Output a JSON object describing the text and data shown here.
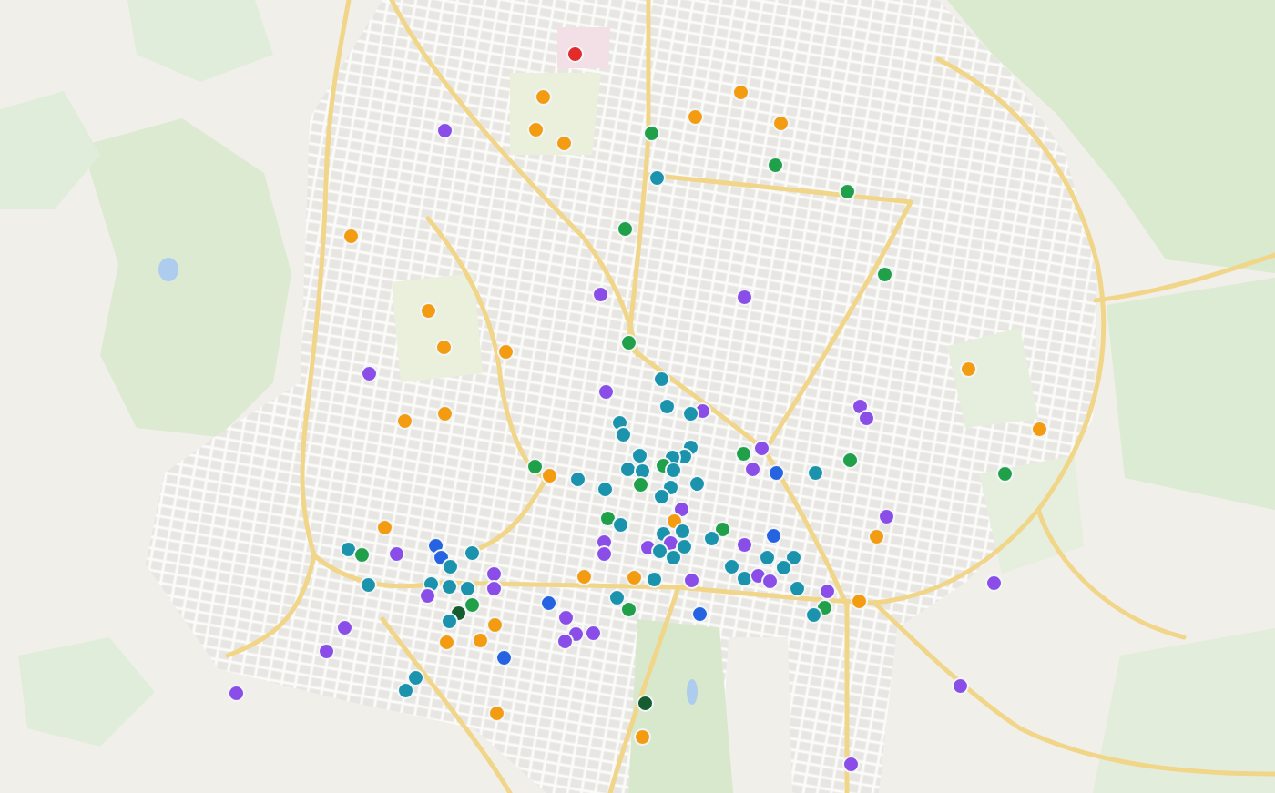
{
  "map": {
    "markers": [
      {
        "color": "#e32b2b"
      },
      {
        "color": "#f39c12"
      },
      {
        "color": "#f39c12"
      },
      {
        "color": "#f39c12"
      },
      {
        "color": "#8b4de8"
      },
      {
        "color": "#21a04a"
      },
      {
        "color": "#f39c12"
      },
      {
        "color": "#f39c12"
      },
      {
        "color": "#f39c12"
      },
      {
        "color": "#21a04a"
      },
      {
        "color": "#1b93ad"
      },
      {
        "color": "#21a04a"
      },
      {
        "color": "#21a04a"
      },
      {
        "color": "#f39c12"
      },
      {
        "color": "#21a04a"
      },
      {
        "color": "#8b4de8"
      },
      {
        "color": "#8b4de8"
      },
      {
        "color": "#f39c12"
      },
      {
        "color": "#f39c12"
      },
      {
        "color": "#f39c12"
      },
      {
        "color": "#21a04a"
      },
      {
        "color": "#8b4de8"
      },
      {
        "color": "#f39c12"
      },
      {
        "color": "#1b93ad"
      },
      {
        "color": "#8b4de8"
      },
      {
        "color": "#1b93ad"
      },
      {
        "color": "#8b4de8"
      },
      {
        "color": "#1b93ad"
      },
      {
        "color": "#8b4de8"
      },
      {
        "color": "#8b4de8"
      },
      {
        "color": "#f39c12"
      },
      {
        "color": "#f39c12"
      },
      {
        "color": "#f39c12"
      },
      {
        "color": "#1b93ad"
      },
      {
        "color": "#1b93ad"
      },
      {
        "color": "#1b93ad"
      },
      {
        "color": "#1b93ad"
      },
      {
        "color": "#1b93ad"
      },
      {
        "color": "#1b93ad"
      },
      {
        "color": "#21a04a"
      },
      {
        "color": "#1b93ad"
      },
      {
        "color": "#1b93ad"
      },
      {
        "color": "#1b93ad"
      },
      {
        "color": "#21a04a"
      },
      {
        "color": "#1b93ad"
      },
      {
        "color": "#21a04a"
      },
      {
        "color": "#f39c12"
      },
      {
        "color": "#1b93ad"
      },
      {
        "color": "#1b93ad"
      },
      {
        "color": "#1b93ad"
      },
      {
        "color": "#1b93ad"
      },
      {
        "color": "#8b4de8"
      },
      {
        "color": "#21a04a"
      },
      {
        "color": "#8b4de8"
      },
      {
        "color": "#2563e0"
      },
      {
        "color": "#1b93ad"
      },
      {
        "color": "#21a04a"
      },
      {
        "color": "#21a04a"
      },
      {
        "color": "#8b4de8"
      },
      {
        "color": "#f39c12"
      },
      {
        "color": "#21a04a"
      },
      {
        "color": "#1b93ad"
      },
      {
        "color": "#1b93ad"
      },
      {
        "color": "#1b93ad"
      },
      {
        "color": "#21a04a"
      },
      {
        "color": "#1b93ad"
      },
      {
        "color": "#2563e0"
      },
      {
        "color": "#8b4de8"
      },
      {
        "color": "#f39c12"
      },
      {
        "color": "#f39c12"
      },
      {
        "color": "#1b93ad"
      },
      {
        "color": "#21a04a"
      },
      {
        "color": "#8b4de8"
      },
      {
        "color": "#2563e0"
      },
      {
        "color": "#2563e0"
      },
      {
        "color": "#1b93ad"
      },
      {
        "color": "#1b93ad"
      },
      {
        "color": "#8b4de8"
      },
      {
        "color": "#8b4de8"
      },
      {
        "color": "#8b4de8"
      },
      {
        "color": "#8b4de8"
      },
      {
        "color": "#1b93ad"
      },
      {
        "color": "#1b93ad"
      },
      {
        "color": "#1b93ad"
      },
      {
        "color": "#8b4de8"
      },
      {
        "color": "#1b93ad"
      },
      {
        "color": "#1b93ad"
      },
      {
        "color": "#1b93ad"
      },
      {
        "color": "#1b93ad"
      },
      {
        "color": "#1b93ad"
      },
      {
        "color": "#8b4de8"
      },
      {
        "color": "#8b4de8"
      },
      {
        "color": "#1b93ad"
      },
      {
        "color": "#8b4de8"
      },
      {
        "color": "#f39c12"
      },
      {
        "color": "#21a04a"
      },
      {
        "color": "#1b93ad"
      },
      {
        "color": "#8b4de8"
      },
      {
        "color": "#8b4de8"
      },
      {
        "color": "#8b4de8"
      },
      {
        "color": "#1b93ad"
      },
      {
        "color": "#1b93ad"
      },
      {
        "color": "#8b4de8"
      },
      {
        "color": "#1b93ad"
      },
      {
        "color": "#1b93ad"
      },
      {
        "color": "#f39c12"
      },
      {
        "color": "#f39c12"
      },
      {
        "color": "#1b93ad"
      },
      {
        "color": "#8b4de8"
      },
      {
        "color": "#2563e0"
      },
      {
        "color": "#1b93ad"
      },
      {
        "color": "#21a04a"
      },
      {
        "color": "#2563e0"
      },
      {
        "color": "#21a04a"
      },
      {
        "color": "#155c30"
      },
      {
        "color": "#1b93ad"
      },
      {
        "color": "#8b4de8"
      },
      {
        "color": "#f39c12"
      },
      {
        "color": "#8b4de8"
      },
      {
        "color": "#f39c12"
      },
      {
        "color": "#f39c12"
      },
      {
        "color": "#8b4de8"
      },
      {
        "color": "#8b4de8"
      },
      {
        "color": "#8b4de8"
      },
      {
        "color": "#8b4de8"
      },
      {
        "color": "#2563e0"
      },
      {
        "color": "#1b93ad"
      },
      {
        "color": "#1b93ad"
      },
      {
        "color": "#8b4de8"
      },
      {
        "color": "#8b4de8"
      },
      {
        "color": "#155c30"
      },
      {
        "color": "#f39c12"
      },
      {
        "color": "#f39c12"
      },
      {
        "color": "#8b4de8"
      }
    ]
  }
}
